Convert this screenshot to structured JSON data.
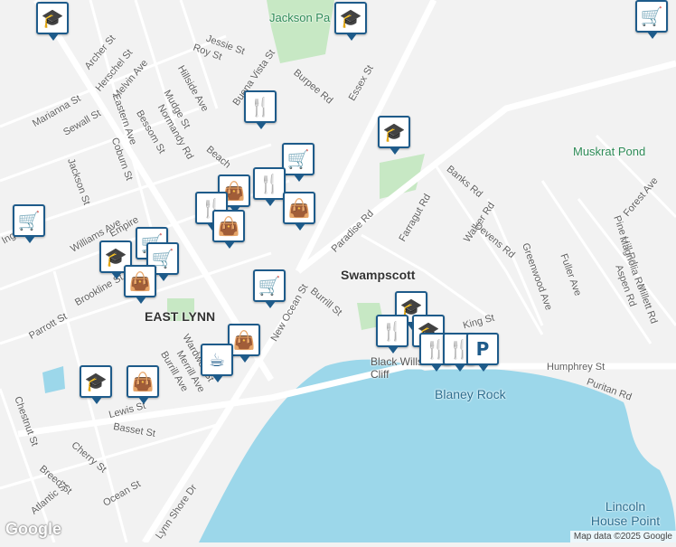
{
  "map": {
    "places": [
      {
        "name": "Swampscott",
        "kind": "place"
      },
      {
        "name": "EAST LYNN",
        "kind": "place"
      },
      {
        "name": "Black Wills Cliff",
        "kind": "place"
      },
      {
        "name": "Blaney Rock",
        "kind": "water"
      },
      {
        "name": "Lincoln House Point",
        "kind": "water"
      },
      {
        "name": "Muskrat Pond",
        "kind": "park"
      },
      {
        "name": "Jackson Pa",
        "kind": "park"
      }
    ],
    "streets": [
      "Archer St",
      "Herschel St",
      "Melvin Ave",
      "Jessie St",
      "Roy St",
      "Buena Vista St",
      "Burpee Rd",
      "Essex St",
      "Marianna St",
      "Sewall St",
      "Eastern Ave",
      "Hillside Ave",
      "Mudge St",
      "Bessom St",
      "Normandy Rd",
      "Coburn St",
      "Jackson St",
      "Williams Ave",
      "Brookline St",
      "Parrott St",
      "Chestnut St",
      "Lewis St",
      "Basset St",
      "Cherry St",
      "Breed St",
      "Atlantic St",
      "Ocean St",
      "Lynn Shore Dr",
      "New Ocean St",
      "Burrill St",
      "Paradise Rd",
      "Farragut Rd",
      "Banks Rd",
      "Walker Rd",
      "Devens Rd",
      "Greenwood Ave",
      "Fuller Ave",
      "Pine Hill Rd",
      "Magnolia Rd",
      "Aspen Rd",
      "Millett Rd",
      "Forest Ave",
      "Humphrey St",
      "Puritan Rd",
      "King St",
      "Wardwell St",
      "Merrill Ave",
      "Burrill Ave",
      "Beach",
      "Empire",
      "Ingalls St"
    ],
    "pins": [
      {
        "icon": "school-icon",
        "glyph": "🎓"
      },
      {
        "icon": "school-icon",
        "glyph": "🎓"
      },
      {
        "icon": "shopping-cart-icon",
        "glyph": "🛒"
      },
      {
        "icon": "restaurant-icon",
        "glyph": "🍴"
      },
      {
        "icon": "school-icon",
        "glyph": "🎓"
      },
      {
        "icon": "shopping-cart-icon",
        "glyph": "🛒"
      },
      {
        "icon": "restaurant-icon",
        "glyph": "🍴"
      },
      {
        "icon": "shopping-bag-icon",
        "glyph": "👜"
      },
      {
        "icon": "shopping-bag-icon",
        "glyph": "👜"
      },
      {
        "icon": "restaurant-icon",
        "glyph": "🍴"
      },
      {
        "icon": "shopping-bag-icon",
        "glyph": "👜"
      },
      {
        "icon": "shopping-cart-icon",
        "glyph": "🛒"
      },
      {
        "icon": "shopping-cart-icon",
        "glyph": "🛒"
      },
      {
        "icon": "school-icon",
        "glyph": "🎓"
      },
      {
        "icon": "shopping-cart-icon",
        "glyph": "🛒"
      },
      {
        "icon": "shopping-bag-icon",
        "glyph": "👜"
      },
      {
        "icon": "shopping-cart-icon",
        "glyph": "🛒"
      },
      {
        "icon": "shopping-bag-icon",
        "glyph": "👜"
      },
      {
        "icon": "cafe-icon",
        "glyph": "☕"
      },
      {
        "icon": "school-icon",
        "glyph": "🎓"
      },
      {
        "icon": "shopping-bag-icon",
        "glyph": "👜"
      },
      {
        "icon": "school-icon",
        "glyph": "🎓"
      },
      {
        "icon": "restaurant-icon",
        "glyph": "🍴"
      },
      {
        "icon": "school-icon",
        "glyph": "🎓"
      },
      {
        "icon": "restaurant-icon",
        "glyph": "🍴"
      },
      {
        "icon": "restaurant-icon",
        "glyph": "🍴"
      },
      {
        "icon": "parking-icon",
        "glyph": "P"
      }
    ],
    "attribution": "Map data ©2025 Google",
    "logo": "Google"
  }
}
